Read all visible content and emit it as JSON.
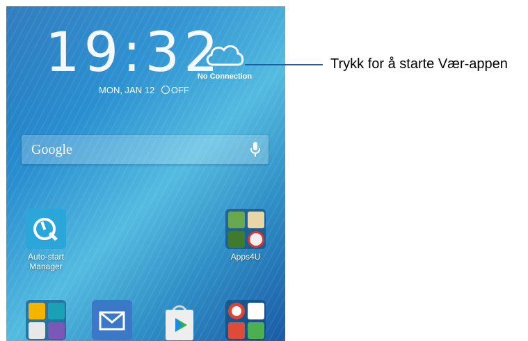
{
  "clock": {
    "time": "19:32",
    "date": "MON, JAN 12",
    "alarm": "OFF"
  },
  "weather": {
    "status": "No Connection",
    "icon": "cloud-icon"
  },
  "search": {
    "label": "Google",
    "icon": "mic-icon"
  },
  "apps": {
    "autostart": {
      "label_line1": "Auto-start",
      "label_line2": "Manager"
    },
    "apps4u": {
      "label": "Apps4U"
    },
    "dock": [
      {
        "name": "productivity-folder"
      },
      {
        "name": "email"
      },
      {
        "name": "play-store"
      },
      {
        "name": "google-folder"
      }
    ]
  },
  "callout": {
    "text": "Trykk for å starte Vær-appen"
  },
  "colors": {
    "wallpaper": "#2a8fd0",
    "callout_line": "#1f5ea8"
  }
}
